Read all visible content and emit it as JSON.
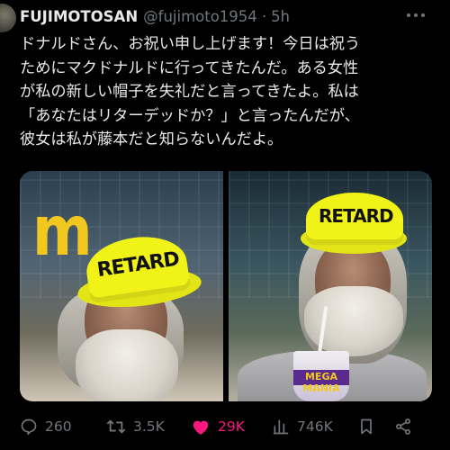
{
  "author": {
    "name": "FUJIMOTOSAN",
    "handle": "@fujimoto1954",
    "separator": "·",
    "time": "5h"
  },
  "tweet": {
    "lines": [
      "ドナルドさん、お祝い申し上げます！今日は祝う",
      "ためにマクドナルドに行ってきたんだ。ある女性",
      "が私の新しい帽子を失礼だと言ってきたよ。私は",
      "「あなたはリターデッドか？」と言ったんだが、",
      "彼女は私が藤本だと知らないんだよ。"
    ]
  },
  "media": {
    "photo1_cap_text": "RETARD",
    "photo2_cap_text": "RETARD",
    "cup_text": "MEGA\nMANIA"
  },
  "actions": {
    "replies": "260",
    "reposts": "3.5K",
    "likes": "29K",
    "views": "746K"
  },
  "icons": {
    "reply": "reply-icon",
    "repost": "repost-icon",
    "like": "heart-icon",
    "views": "views-icon",
    "bookmark": "bookmark-icon",
    "share": "share-icon",
    "more": "more-icon"
  },
  "colors": {
    "background": "#000000",
    "text": "#e7e9ea",
    "muted": "#71767b",
    "like": "#f91880"
  }
}
